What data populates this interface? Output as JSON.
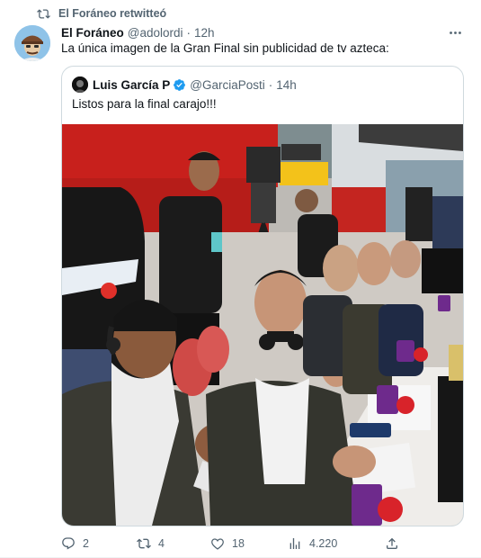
{
  "retweet": {
    "label": "El Foráneo retwitteó",
    "icon": "retweet-icon"
  },
  "tweet": {
    "author_name": "El Foráneo",
    "author_handle": "@adolordi",
    "separator": "·",
    "time": "12h",
    "text": "La única imagen de la Gran Final sin publicidad de tv azteca:"
  },
  "quote": {
    "author_name": "Luis García P",
    "author_handle": "@GarciaPosti",
    "separator": "·",
    "time": "14h",
    "text": "Listos para la final carajo!!!",
    "verified_icon": "verified-badge-icon"
  },
  "actions": {
    "replies": "2",
    "retweets": "4",
    "likes": "18",
    "views": "4.220"
  },
  "colors": {
    "accent": "#1d9bf0",
    "muted": "#536471",
    "stadium_red": "#c8201c",
    "mic_tv_azteca": "#6e2a8c"
  }
}
